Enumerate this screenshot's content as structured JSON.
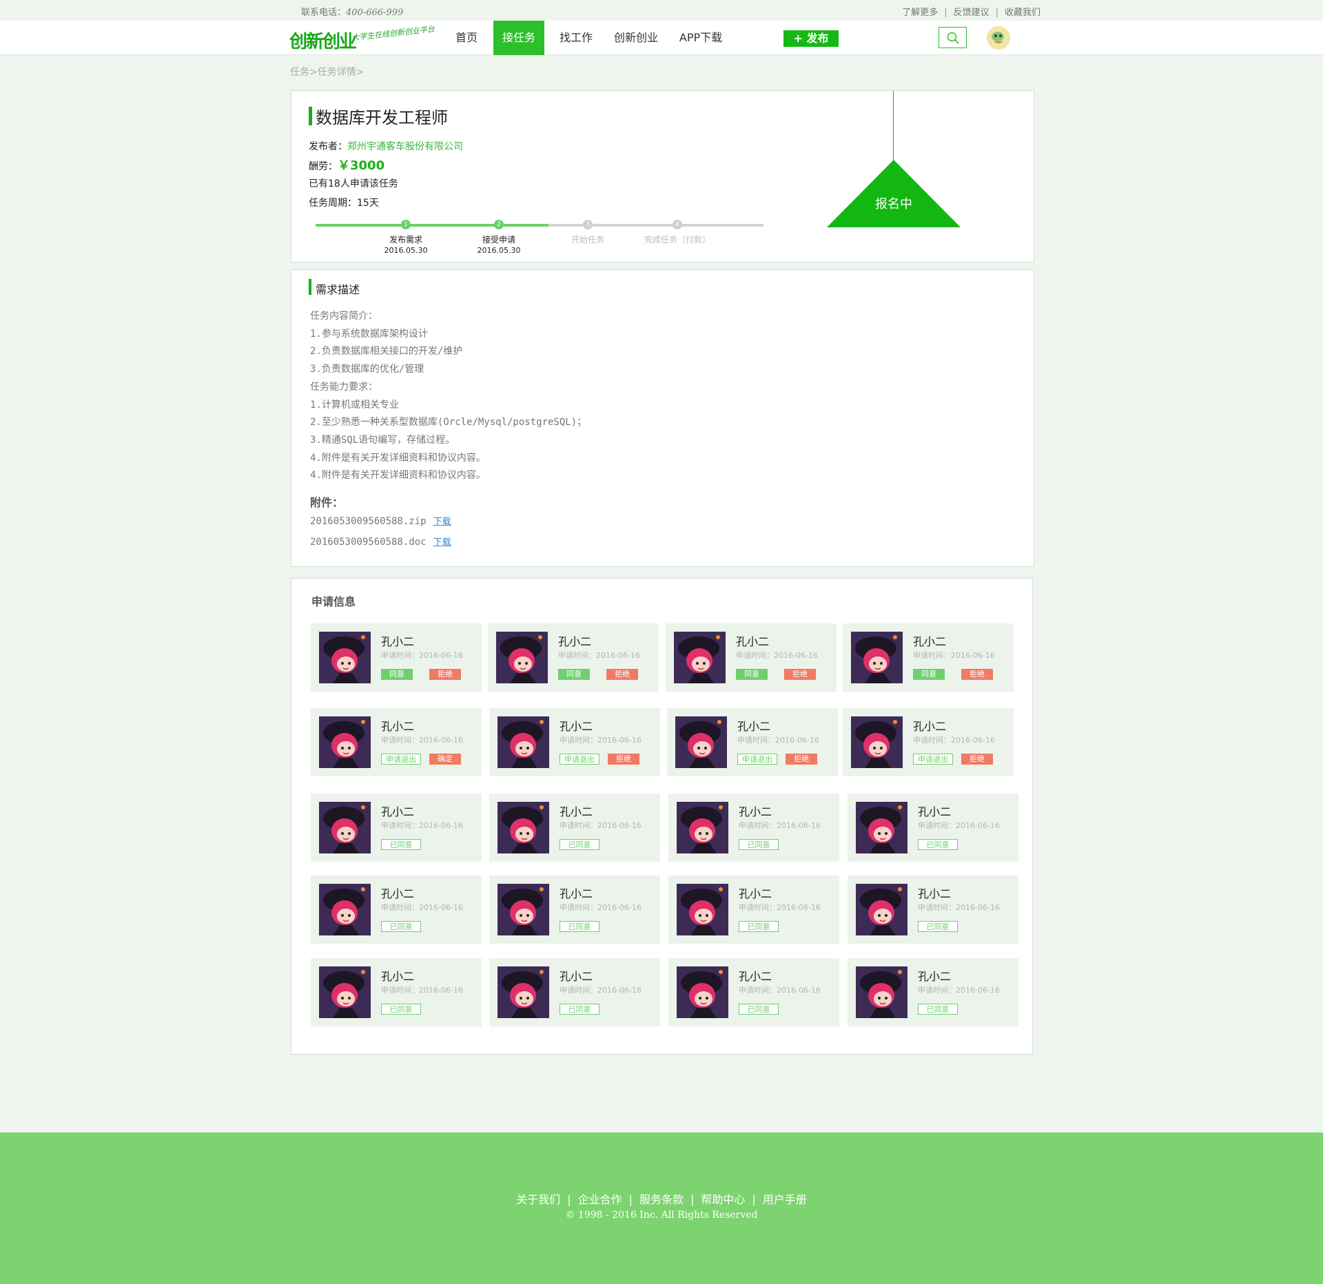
{
  "topbar": {
    "phone_label": "联系电话：",
    "phone_number": "400-666-999",
    "links": [
      "了解更多",
      "反馈建议",
      "收藏我们"
    ]
  },
  "header": {
    "logo_text": "创新创业",
    "logo_tagline": "大学生在线创新创业平台",
    "nav": [
      "首页",
      "接任务",
      "找工作",
      "创新创业",
      "APP下载"
    ],
    "active_nav": "接任务",
    "publish_label": "+ 发布",
    "icons": [
      "search-icon",
      "user-avatar"
    ]
  },
  "breadcrumb": "任务>任务详情>",
  "task": {
    "title": "数据库开发工程师",
    "publisher_label": "发布者：",
    "publisher": "郑州宇通客车股份有限公司",
    "reward_label": "酬劳：",
    "reward": "￥3000",
    "applicants_text": "已有18人申请该任务",
    "period_label": "任务周期：",
    "period": "15天",
    "status_badge": "报名中",
    "progress_fraction": 0.52,
    "steps": [
      {
        "num": "1",
        "label": "发布需求",
        "date": "2016.05.30",
        "done": true
      },
      {
        "num": "2",
        "label": "接受申请",
        "date": "2016.05.30",
        "done": true
      },
      {
        "num": "3",
        "label": "开始任务",
        "date": "",
        "done": false
      },
      {
        "num": "4",
        "label": "完成任务（付款）",
        "date": "",
        "done": false
      }
    ]
  },
  "requirements": {
    "section_title": "需求描述",
    "lines": [
      "任务内容简介：",
      "1.参与系统数据库架构设计",
      "2.负责数据库相关接口的开发/维护",
      "3.负责数据库的优化/管理",
      "任务能力要求：",
      "1.计算机或相关专业",
      "2.至少熟悉一种关系型数据库(Orcle/Mysql/postgreSQL)；",
      "3.精通SQL语句编写，存储过程。",
      "4.附件是有关开发详细资料和协议内容。",
      "4.附件是有关开发详细资料和协议内容。"
    ],
    "attachments_label": "附件：",
    "attachments": [
      {
        "file": "2016053009560588.zip",
        "action": "下载"
      },
      {
        "file": "2016053009560588.doc",
        "action": "下载"
      }
    ]
  },
  "applications": {
    "section_title": "申请信息",
    "applicant_name": "孔小二",
    "apply_time": "申请时间：2016-06-16",
    "btn_agree": "同意",
    "btn_reject": "拒绝",
    "btn_withdraw": "申请退出",
    "btn_confirm": "确定",
    "btn_agreed": "已同意"
  },
  "footer": {
    "links": [
      "关于我们",
      "企业合作",
      "服务条款",
      "帮助中心",
      "用户手册"
    ],
    "copyright": "© 1998 - 2016  Inc. All Rights Reserved"
  }
}
